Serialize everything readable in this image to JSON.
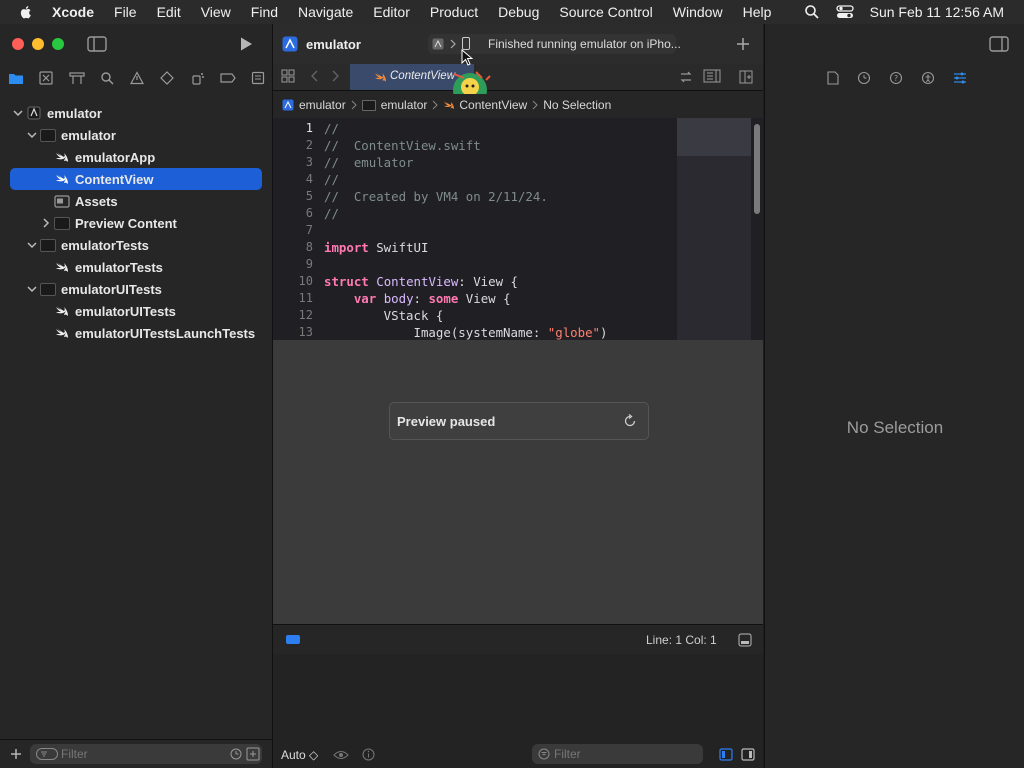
{
  "menubar": {
    "app_name": "Xcode",
    "items": [
      "File",
      "Edit",
      "View",
      "Find",
      "Navigate",
      "Editor",
      "Product",
      "Debug",
      "Source Control",
      "Window",
      "Help"
    ],
    "clock": "Sun Feb 11  12:56 AM"
  },
  "toolbar": {
    "scheme_name": "emulator",
    "activity_status": "Finished running emulator on iPho..."
  },
  "navigator": {
    "tree": [
      {
        "label": "emulator",
        "level": 0,
        "kind": "project",
        "expanded": true
      },
      {
        "label": "emulator",
        "level": 1,
        "kind": "folder",
        "expanded": true
      },
      {
        "label": "emulatorApp",
        "level": 2,
        "kind": "swift"
      },
      {
        "label": "ContentView",
        "level": 2,
        "kind": "swift",
        "selected": true
      },
      {
        "label": "Assets",
        "level": 2,
        "kind": "assets"
      },
      {
        "label": "Preview Content",
        "level": 2,
        "kind": "folder",
        "expanded": false
      },
      {
        "label": "emulatorTests",
        "level": 1,
        "kind": "folder",
        "expanded": true
      },
      {
        "label": "emulatorTests",
        "level": 2,
        "kind": "swift"
      },
      {
        "label": "emulatorUITests",
        "level": 1,
        "kind": "folder",
        "expanded": true
      },
      {
        "label": "emulatorUITests",
        "level": 2,
        "kind": "swift"
      },
      {
        "label": "emulatorUITestsLaunchTests",
        "level": 2,
        "kind": "swift"
      }
    ],
    "filter_placeholder": "Filter"
  },
  "editor": {
    "tab_label": "ContentView",
    "breadcrumb": [
      "emulator",
      "emulator",
      "ContentView",
      "No Selection"
    ],
    "code_lines": [
      [
        {
          "t": "//",
          "c": "cm"
        }
      ],
      [
        {
          "t": "//  ContentView.swift",
          "c": "cm"
        }
      ],
      [
        {
          "t": "//  emulator",
          "c": "cm"
        }
      ],
      [
        {
          "t": "//",
          "c": "cm"
        }
      ],
      [
        {
          "t": "//  Created by VM4 on 2/11/24.",
          "c": "cm"
        }
      ],
      [
        {
          "t": "//",
          "c": "cm"
        }
      ],
      [],
      [
        {
          "t": "import",
          "c": "kw"
        },
        {
          "t": " SwiftUI",
          "c": ""
        }
      ],
      [],
      [
        {
          "t": "struct",
          "c": "kw"
        },
        {
          "t": " ",
          "c": ""
        },
        {
          "t": "ContentView",
          "c": "ty"
        },
        {
          "t": ": View {",
          "c": ""
        }
      ],
      [
        {
          "t": "    ",
          "c": ""
        },
        {
          "t": "var",
          "c": "kw"
        },
        {
          "t": " ",
          "c": ""
        },
        {
          "t": "body",
          "c": "ty"
        },
        {
          "t": ": ",
          "c": ""
        },
        {
          "t": "some",
          "c": "kw"
        },
        {
          "t": " View {",
          "c": ""
        }
      ],
      [
        {
          "t": "        VStack {",
          "c": ""
        }
      ],
      [
        {
          "t": "            Image(systemName: ",
          "c": ""
        },
        {
          "t": "\"globe\"",
          "c": "str"
        },
        {
          "t": ")",
          "c": ""
        }
      ]
    ],
    "preview_status": "Preview paused",
    "cursor_position": "Line: 1  Col: 1",
    "debug_scope": "Auto ◇",
    "debug_filter_placeholder": "Filter"
  },
  "inspector": {
    "empty_label": "No Selection"
  },
  "colors": {
    "accent": "#1d5fd6",
    "keyword": "#ff7ab2",
    "type": "#dabaff",
    "string": "#ff8170",
    "comment": "#7f8c8d"
  }
}
